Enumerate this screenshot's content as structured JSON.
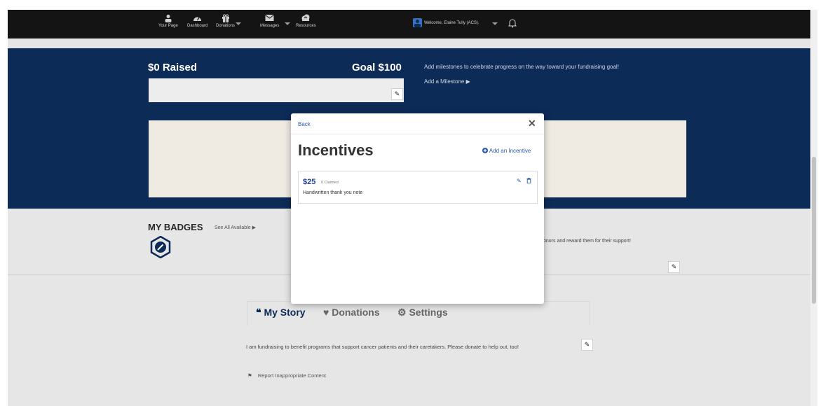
{
  "nav": {
    "items": [
      {
        "label": "Your Page",
        "icon": "user-icon"
      },
      {
        "label": "Dashboard",
        "icon": "dashboard-icon"
      },
      {
        "label": "Donations",
        "icon": "gift-icon"
      },
      {
        "label": "Messages",
        "icon": "envelope-icon"
      },
      {
        "label": "Resources",
        "icon": "cloud-icon"
      }
    ],
    "welcome": "Welcome, Elaine Tully (ACS)."
  },
  "hero": {
    "raised": "$0 Raised",
    "goal": "Goal $100",
    "milestone_text": "Add milestones to celebrate progress on the way toward your fundraising goal!",
    "milestone_link": "Add a Milestone ▶"
  },
  "badges": {
    "title": "MY BADGES",
    "see_all": "See All Available ▶",
    "reward_text": "onors and reward them for their support!"
  },
  "tabs": {
    "story": "My Story",
    "donations": "Donations",
    "settings": "Settings"
  },
  "story_text": "I am fundraising to benefit programs that support cancer patients and their caretakers. Please donate to help out, too!",
  "report_label": "Report Inappropriate Content",
  "modal": {
    "back": "Back",
    "title": "Incentives",
    "add": "Add an Incentive",
    "incentives": [
      {
        "amount": "$25",
        "claimed": "0 Claimed",
        "description": "Handwritten thank you note"
      }
    ]
  }
}
